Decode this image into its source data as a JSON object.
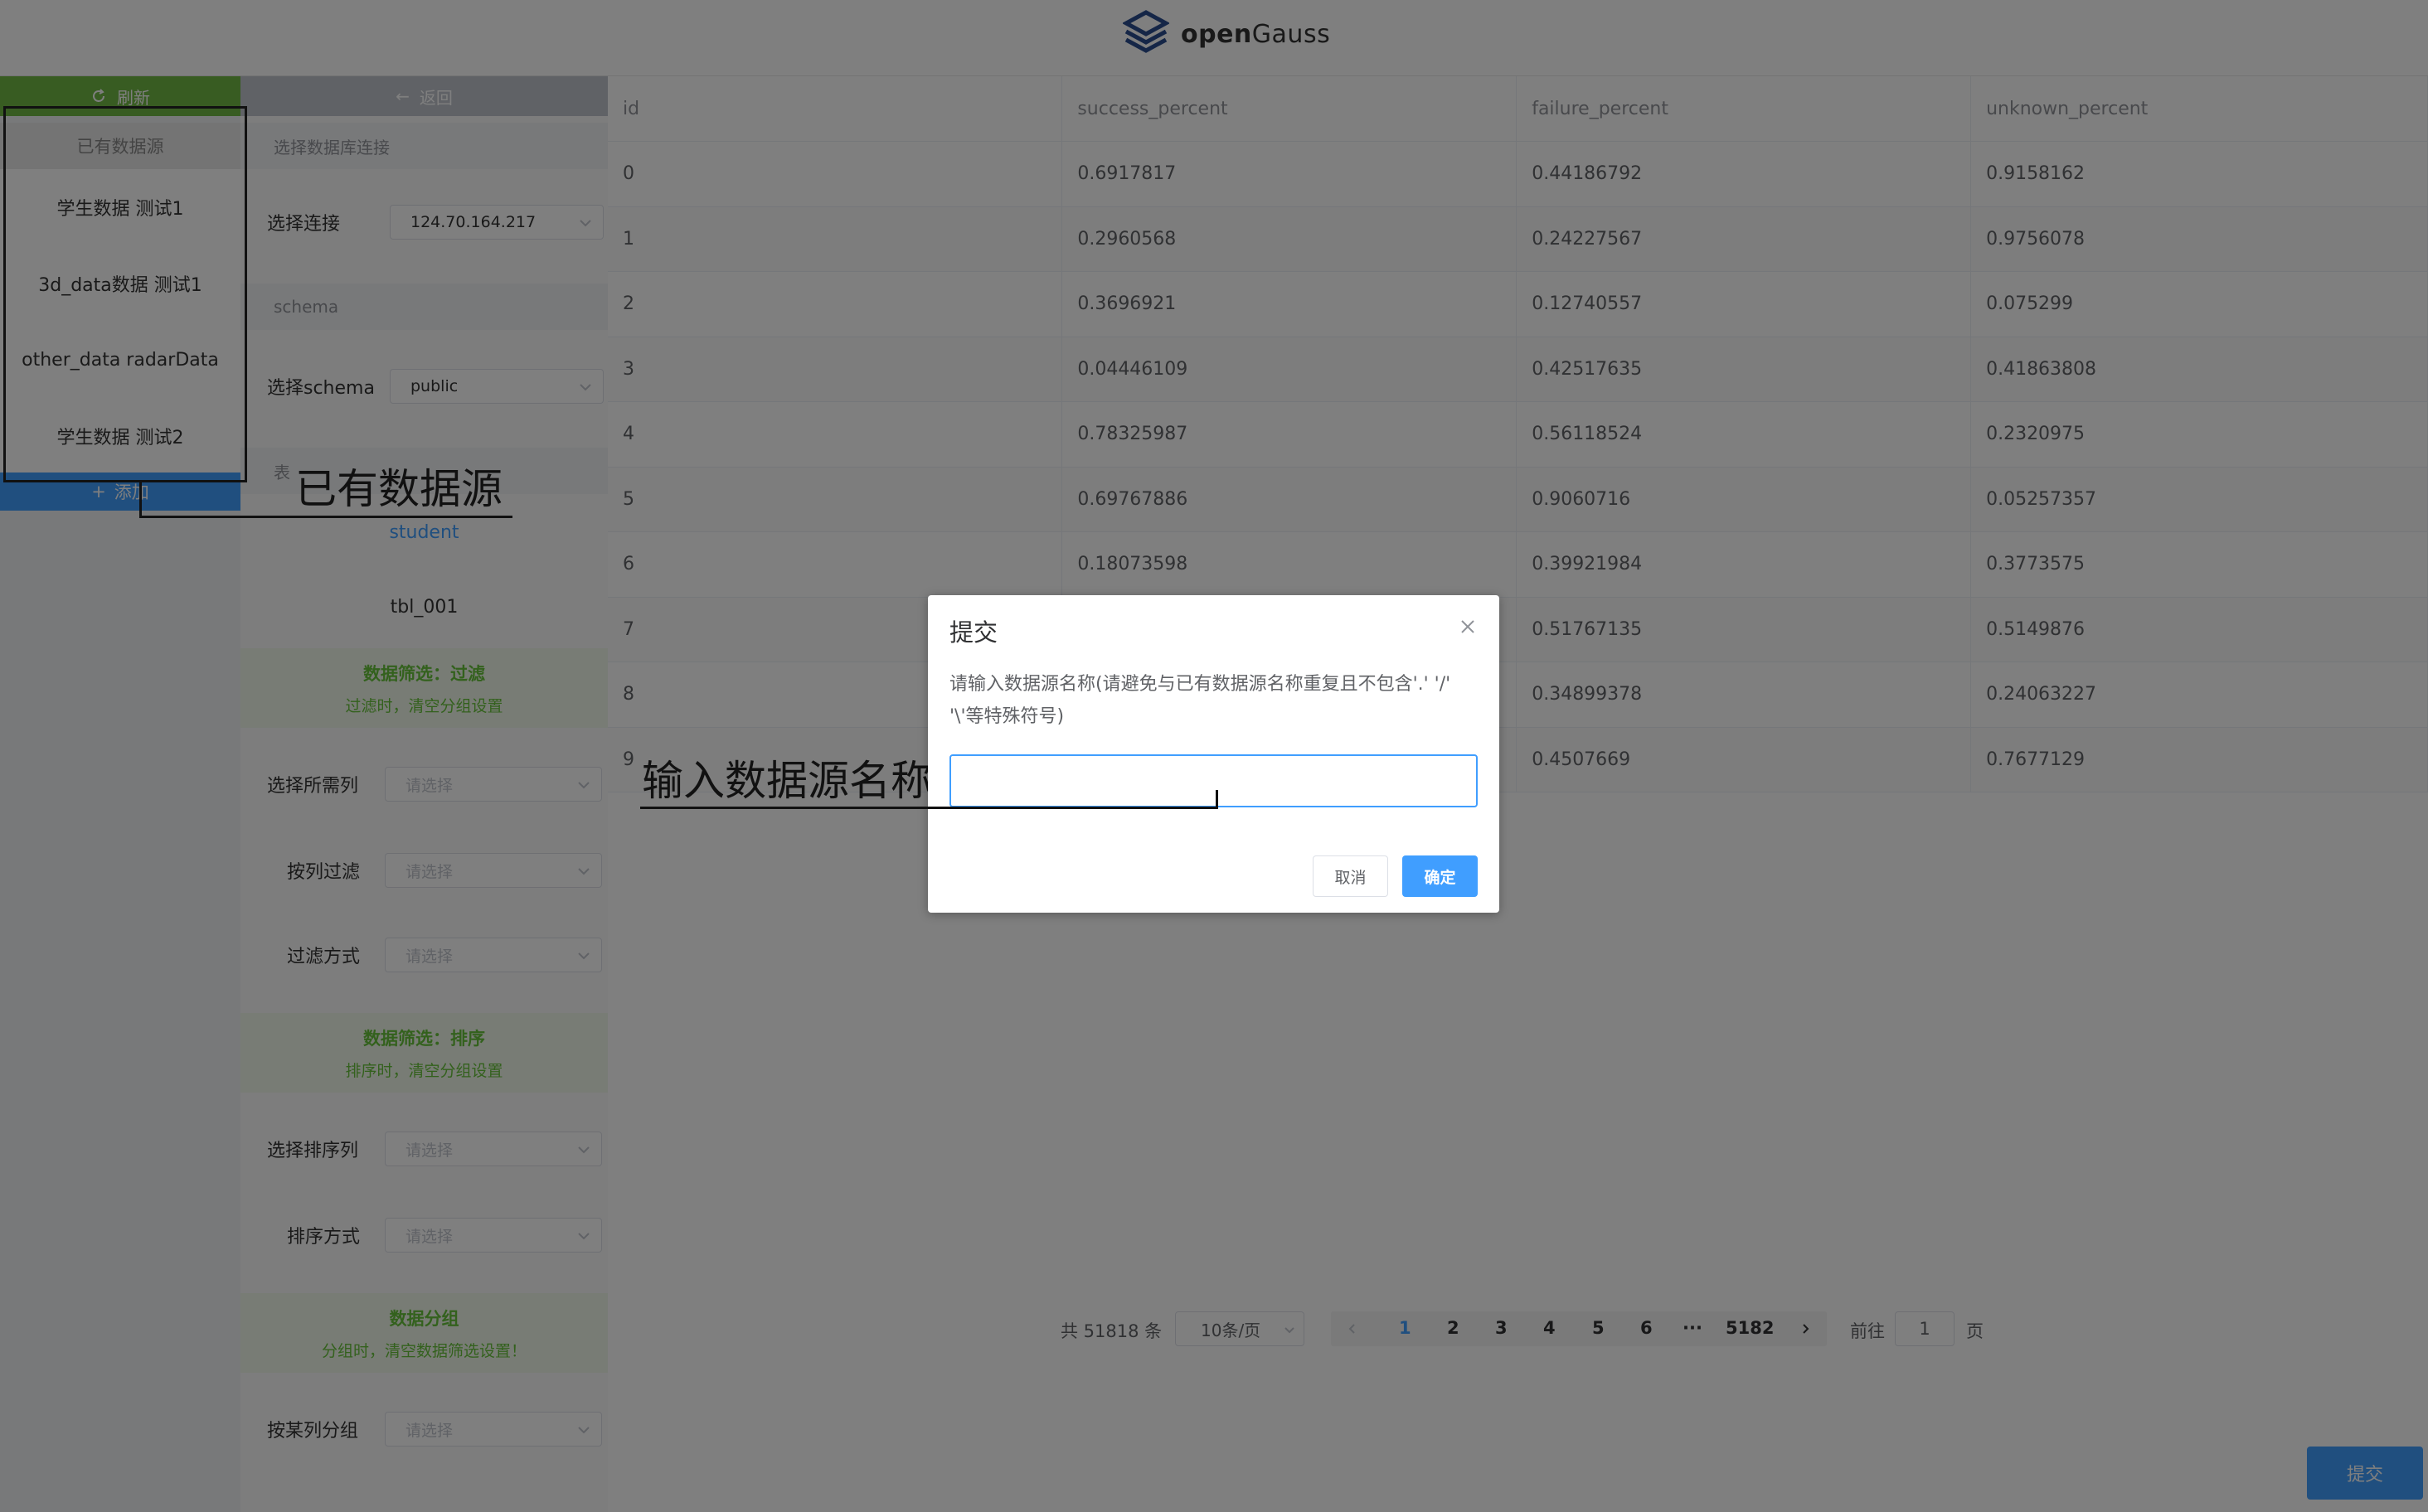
{
  "header": {
    "logo_prefix": "open",
    "logo_suffix": "Gauss"
  },
  "left": {
    "refresh_label": "刷新",
    "datasource_header": "已有数据源",
    "datasources": [
      "学生数据 测试1",
      "3d_data数据 测试1",
      "other_data radarData",
      "学生数据 测试2"
    ],
    "add_label": "添加"
  },
  "mid": {
    "back_label": "返回",
    "db_section": "选择数据库连接",
    "connection_label": "选择连接",
    "connection_value": "124.70.164.217",
    "schema_section": "schema",
    "schema_label": "选择schema",
    "schema_value": "public",
    "table_section": "表",
    "tables": [
      "student",
      "tbl_001"
    ],
    "filter_title": "数据筛选：过滤",
    "filter_sub": "过滤时，清空分组设置",
    "need_col_label": "选择所需列",
    "col_filter_label": "按列过滤",
    "filter_mode_label": "过滤方式",
    "sort_title": "数据筛选：排序",
    "sort_sub": "排序时，清空分组设置",
    "sort_col_label": "选择排序列",
    "sort_mode_label": "排序方式",
    "group_title": "数据分组",
    "group_sub": "分组时，清空数据筛选设置！",
    "group_col_label": "按某列分组",
    "placeholder": "请选择"
  },
  "table": {
    "columns": [
      "id",
      "success_percent",
      "failure_percent",
      "unknown_percent"
    ],
    "rows": [
      [
        "0",
        "0.6917817",
        "0.44186792",
        "0.9158162"
      ],
      [
        "1",
        "0.2960568",
        "0.24227567",
        "0.9756078"
      ],
      [
        "2",
        "0.3696921",
        "0.12740557",
        "0.075299"
      ],
      [
        "3",
        "0.04446109",
        "0.42517635",
        "0.41863808"
      ],
      [
        "4",
        "0.78325987",
        "0.56118524",
        "0.2320975"
      ],
      [
        "5",
        "0.69767886",
        "0.9060716",
        "0.05257357"
      ],
      [
        "6",
        "0.18073598",
        "0.39921984",
        "0.3773575"
      ],
      [
        "7",
        "",
        "0.51767135",
        "0.5149876"
      ],
      [
        "8",
        "",
        "0.34899378",
        "0.24063227"
      ],
      [
        "9",
        "",
        "0.4507669",
        "0.7677129"
      ]
    ]
  },
  "pagination": {
    "total": "共 51818 条",
    "page_size": "10条/页",
    "pages": [
      "1",
      "2",
      "3",
      "4",
      "5",
      "6",
      "···",
      "5182"
    ],
    "goto_label": "前往",
    "goto_value": "1",
    "page_suffix": "页"
  },
  "submit_label": "提交",
  "dialog": {
    "title": "提交",
    "message": "请输入数据源名称(请避免与已有数据源名称重复且不包含'.' '/' '\\'等特殊符号)",
    "input_value": "",
    "cancel_label": "取消",
    "ok_label": "确定"
  },
  "annotations": {
    "datasource_note": "已有数据源",
    "input_note": "输入数据源名称"
  },
  "colors": {
    "primary": "#409eff",
    "green": "#70b845",
    "success_text": "#67c23a"
  }
}
